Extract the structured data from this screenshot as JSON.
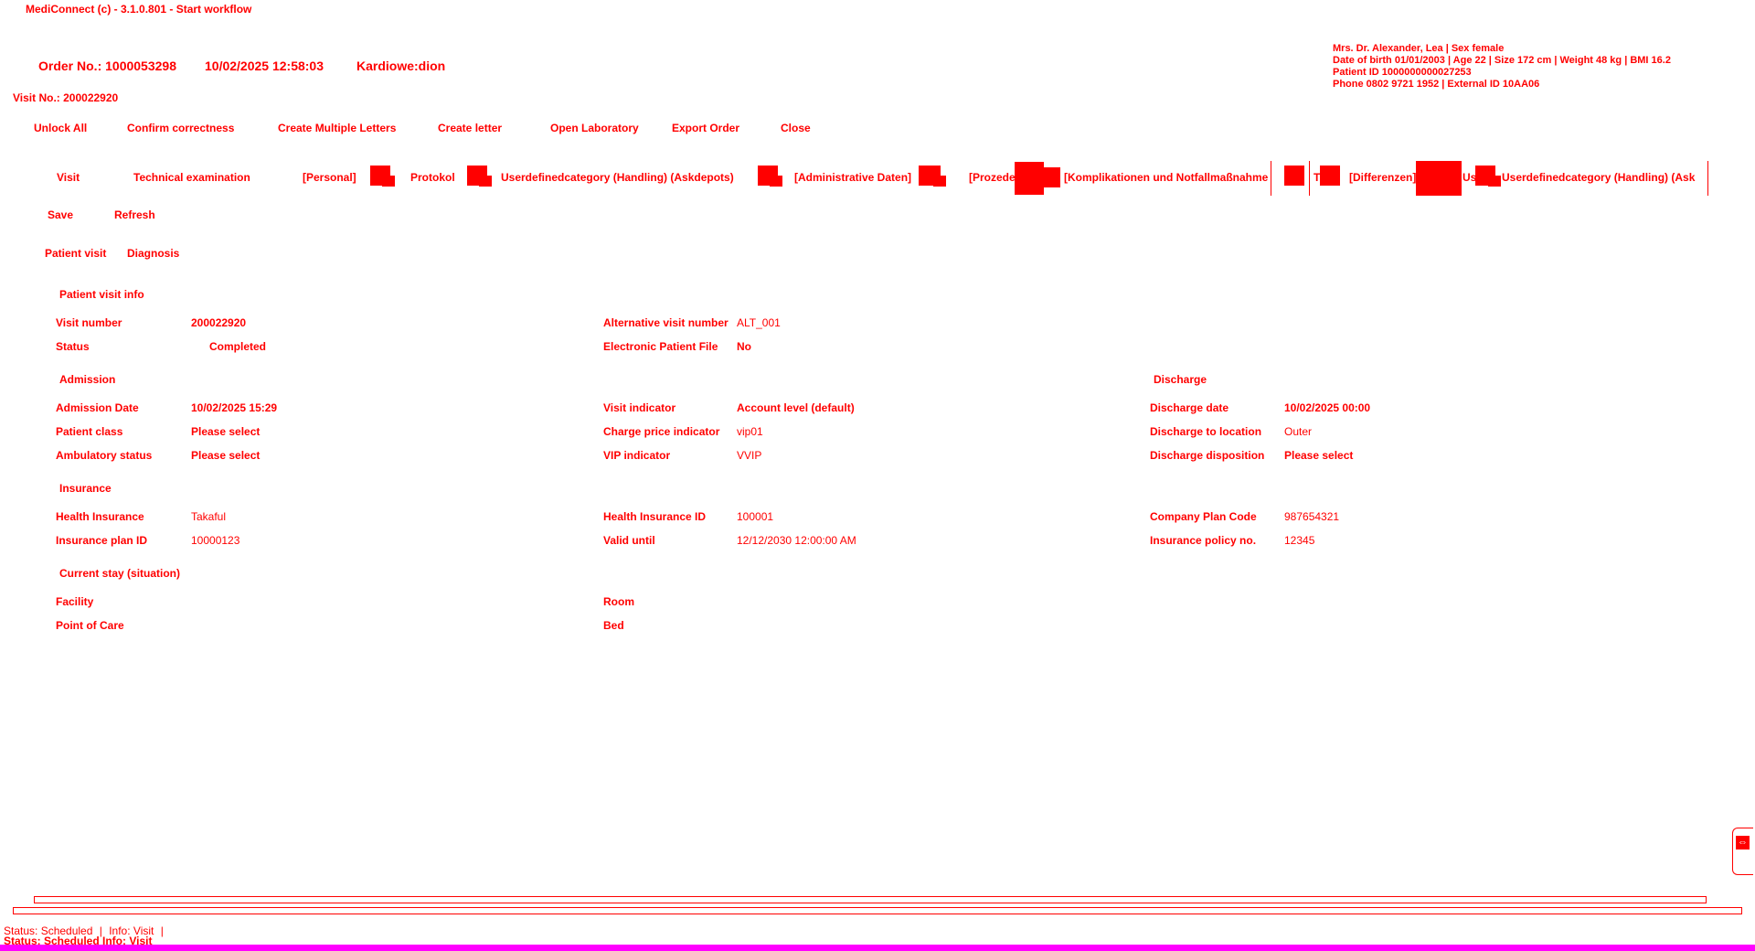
{
  "app": {
    "title": "MediConnect (c) - 3.1.0.801 - Start workflow"
  },
  "order": {
    "number": "Order No.: 1000053298",
    "datetime": "10/02/2025 12:58:03",
    "department": "Kardiowe:dion"
  },
  "patient": {
    "line1": "Mrs. Dr. Alexander, Lea | Sex female",
    "line2": "Date of birth 01/01/2003 | Age 22 | Size 172 cm | Weight 48 kg | BMI 16.2",
    "line3": "Patient ID 1000000000027253",
    "line4": "Phone 0802 9721 1952 | External ID 10AA06"
  },
  "visit_no": "Visit No.: 200022920",
  "toolbar": {
    "unlock_all": "Unlock All",
    "confirm": "Confirm correctness",
    "create_multiple": "Create Multiple Letters",
    "create_letter": "Create letter",
    "open_lab": "Open Laboratory",
    "export_order": "Export Order",
    "close": "Close"
  },
  "tabs": {
    "visit": "Visit",
    "technical": "Technical examination",
    "personal": "[Personal]",
    "protocol": "Protokol",
    "userdefined1": "Userdefinedcategory (Handling) (Askdepots)",
    "admin": "[Administrative Daten]",
    "procedure": "[Prozedere]",
    "complications": "[Komplikationen und Notfallmaßnahmen]",
    "tvs": "TVS",
    "differenzen": "[Differenzen] CD",
    "us": "Us",
    "userdefined2": "Userdefinedcategory (Handling) (Ask"
  },
  "actions": {
    "save": "Save",
    "refresh": "Refresh"
  },
  "subtabs": {
    "patient_visit": "Patient visit",
    "diagnosis": "Diagnosis"
  },
  "sections": {
    "patient_visit_info": "Patient visit info",
    "admission": "Admission",
    "discharge": "Discharge",
    "insurance": "Insurance",
    "current_stay": "Current stay (situation)"
  },
  "fields": {
    "visit_number": {
      "label": "Visit number",
      "value": "200022920"
    },
    "status": {
      "label": "Status",
      "value": "Completed"
    },
    "alt_visit_number": {
      "label": "Alternative visit number",
      "value": "ALT_001"
    },
    "electronic_file": {
      "label": "Electronic Patient File",
      "value": "No"
    },
    "admission_date": {
      "label": "Admission Date",
      "value": "10/02/2025 15:29"
    },
    "patient_class": {
      "label": "Patient class",
      "value": "Please select"
    },
    "ambulatory_status": {
      "label": "Ambulatory status",
      "value": "Please select"
    },
    "visit_indicator": {
      "label": "Visit indicator",
      "value": "Account level (default)"
    },
    "charge_price": {
      "label": "Charge price indicator",
      "value": "vip01"
    },
    "vip_indicator": {
      "label": "VIP indicator",
      "value": "VVIP"
    },
    "discharge_date": {
      "label": "Discharge date",
      "value": "10/02/2025 00:00"
    },
    "discharge_location": {
      "label": "Discharge to location",
      "value": "Outer"
    },
    "discharge_disposition": {
      "label": "Discharge disposition",
      "value": "Please select"
    },
    "health_insurance": {
      "label": "Health Insurance",
      "value": "Takaful"
    },
    "insurance_plan_id": {
      "label": "Insurance plan ID",
      "value": "10000123"
    },
    "health_insurance_id": {
      "label": "Health Insurance ID",
      "value": "100001"
    },
    "valid_until": {
      "label": "Valid until",
      "value": "12/12/2030 12:00:00 AM"
    },
    "company_plan_code": {
      "label": "Company Plan Code",
      "value": "987654321"
    },
    "insurance_policy_no": {
      "label": "Insurance policy no.",
      "value": "12345"
    },
    "facility": {
      "label": "Facility",
      "value": ""
    },
    "point_of_care": {
      "label": "Point of Care",
      "value": ""
    },
    "room": {
      "label": "Room",
      "value": ""
    },
    "bed": {
      "label": "Bed",
      "value": ""
    }
  },
  "statusbar": {
    "line1_status": "Status: Scheduled",
    "line1_info": "Info: Visit",
    "line2": "Status: Scheduled  Info: Visit"
  },
  "colors": {
    "foreground": "#ff0000",
    "accent_bar": "#ff00ff",
    "background": "#ffffff"
  },
  "icons": {
    "side_panel": "expand-panel-icon",
    "tab_icon": "document-icon"
  }
}
